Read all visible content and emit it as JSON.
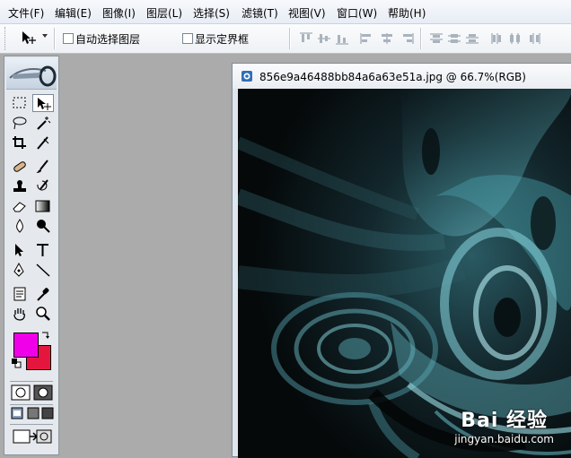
{
  "menubar": {
    "items": [
      "文件(F)",
      "编辑(E)",
      "图像(I)",
      "图层(L)",
      "选择(S)",
      "滤镜(T)",
      "视图(V)",
      "窗口(W)",
      "帮助(H)"
    ]
  },
  "options": {
    "auto_select_label": "自动选择图层",
    "show_bounds_label": "显示定界框"
  },
  "document": {
    "title": "856e9a46488bb84a6a63e51a.jpg @ 66.7%(RGB)"
  },
  "colors": {
    "foreground": "#f000e8",
    "background": "#e5163d"
  },
  "watermark": {
    "logo": "Bai 经验",
    "url": "jingyan.baidu.com"
  }
}
